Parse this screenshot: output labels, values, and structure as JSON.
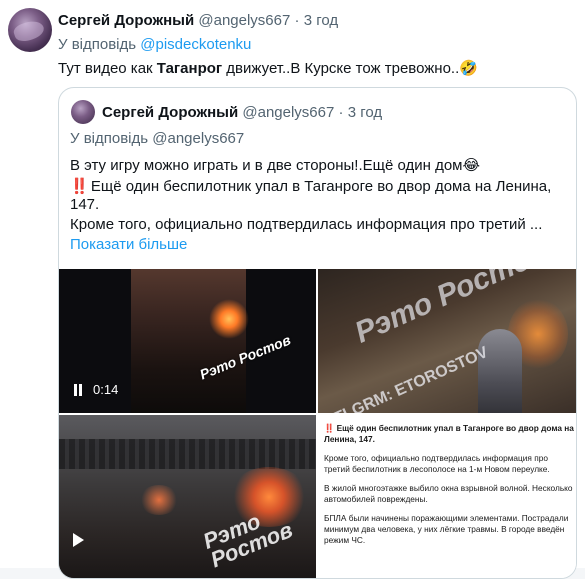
{
  "tweet": {
    "author_name": "Сергей Дорожный",
    "author_handle": "@angelys667",
    "separator": "·",
    "time": "3 год",
    "reply_prefix": "У відповідь",
    "reply_to": "@pisdeckotenku",
    "text_before": "Тут видео как ",
    "text_bold": "Таганрог",
    "text_after": " движует..В Курске тож тревожно..",
    "emoji": "🤣"
  },
  "quote": {
    "author_name": "Сергей Дорожный",
    "author_handle": "@angelys667",
    "separator": "·",
    "time": "3 год",
    "reply_prefix": "У відповідь",
    "reply_to": "@angelys667",
    "line1": "В эту игру можно играть и в две стороны!.Ещё один дом",
    "line1_emoji": "😂",
    "line2_bang": "‼️",
    "line2": " Ещё один беспилотник упал в Таганроге во двор дома на Ленина,",
    "line3": "147.",
    "line4": "Кроме того, официально подтвердилась информация про третий ...",
    "show_more": "Показати більше"
  },
  "media": {
    "video_time": "0:14",
    "watermark_1": "Рэто Ростов",
    "watermark_2": "TLGRM: ETOROSTOV",
    "news_headline_bang": "‼️",
    "news_headline": " Ещё один беспилотник упал в Таганроге во двор дома на Ленина, 147.",
    "news_p1": "Кроме того, официально подтвердилась информация про третий беспилотник в лесополосе на 1-м Новом переулке.",
    "news_p2": "В жилой многоэтажке выбило окна взрывной волной. Несколько автомобилей повреждены.",
    "news_p3": "БПЛА были начинены поражающими элементами. Пострадали минимум два человека, у них лёгкие травмы. В городе введён режим ЧС."
  },
  "icons": [
    "pause-icon",
    "play-icon"
  ],
  "colors": {
    "link": "#1d9bf0",
    "muted": "#536471",
    "border": "#cfd9de",
    "text": "#0f1419"
  }
}
